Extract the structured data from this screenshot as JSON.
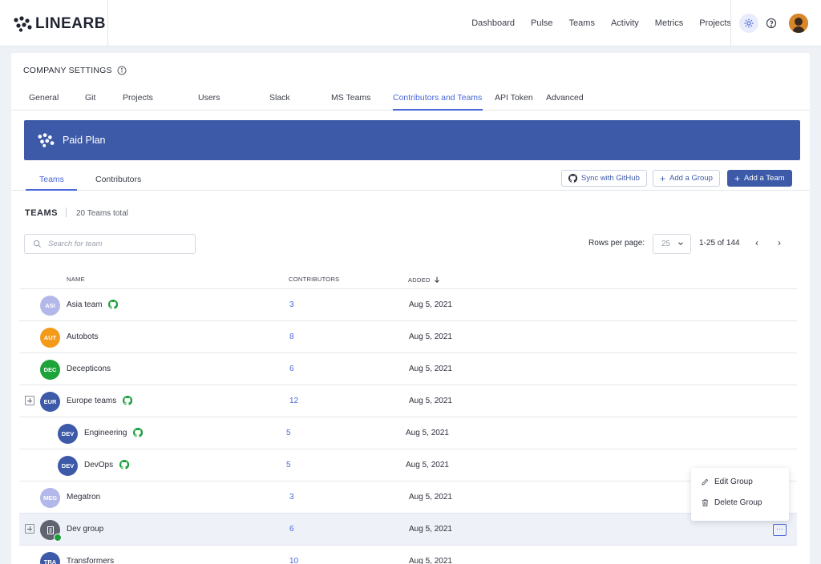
{
  "brand": {
    "name": "LINEARB"
  },
  "nav": [
    "Dashboard",
    "Pulse",
    "Teams",
    "Activity",
    "Metrics",
    "Projects"
  ],
  "settings": {
    "title": "COMPANY SETTINGS",
    "tabs": [
      "General",
      "Git",
      "Projects",
      "Users",
      "Slack",
      "MS Teams",
      "Contributors and Teams",
      "API Token",
      "Advanced"
    ],
    "active_tab": "Contributors and Teams"
  },
  "banner": {
    "text": "Paid Plan"
  },
  "subtabs": {
    "teams": "Teams",
    "contributors": "Contributors"
  },
  "actions": {
    "sync": "Sync with GitHub",
    "add_group": "Add a Group",
    "add_team": "Add a Team"
  },
  "teams_header": {
    "title": "TEAMS",
    "count": "20 Teams total"
  },
  "search": {
    "placeholder": "Search for team"
  },
  "pagination": {
    "rows_label": "Rows per page:",
    "rows_value": "25",
    "range": "1-25 of 144"
  },
  "table": {
    "columns": {
      "name": "NAME",
      "contributors": "CONTRIBUTORS",
      "added": "ADDED"
    },
    "rows": [
      {
        "initials": "ASI",
        "name": "Asia team",
        "github": true,
        "contributors": "3",
        "added": "Aug 5, 2021",
        "color": "#b3b8ea"
      },
      {
        "initials": "AUT",
        "name": "Autobots",
        "github": false,
        "contributors": "8",
        "added": "Aug 5, 2021",
        "color": "#f39a1a"
      },
      {
        "initials": "DEC",
        "name": "Decepticons",
        "github": false,
        "contributors": "6",
        "added": "Aug 5, 2021",
        "color": "#1ea33b"
      },
      {
        "initials": "EUR",
        "name": "Europe teams",
        "github": true,
        "contributors": "12",
        "added": "Aug 5, 2021",
        "color": "#3d5aa8"
      },
      {
        "initials": "DEV",
        "name": "Engineering",
        "github": true,
        "contributors": "5",
        "added": "Aug 5, 2021",
        "color": "#3d5aa8"
      },
      {
        "initials": "DEV",
        "name": "DevOps",
        "github": true,
        "contributors": "5",
        "added": "Aug 5, 2021",
        "color": "#3d5aa8"
      },
      {
        "initials": "MEG",
        "name": "Megatron",
        "github": false,
        "contributors": "3",
        "added": "Aug 5, 2021",
        "color": "#b3b8ea"
      },
      {
        "initials": "",
        "name": "Dev group",
        "github": false,
        "contributors": "6",
        "added": "Aug 5, 2021",
        "color": "#5f6470"
      },
      {
        "initials": "TRA",
        "name": "Transformers",
        "github": false,
        "contributors": "10",
        "added": "Aug 5, 2021",
        "color": "#3d5aa8"
      }
    ]
  },
  "context_menu": {
    "edit": "Edit Group",
    "delete": "Delete Group"
  },
  "colors": {
    "accent": "#4a68d8",
    "brand": "#3d5aa8",
    "github_green": "#1a9e3a"
  }
}
